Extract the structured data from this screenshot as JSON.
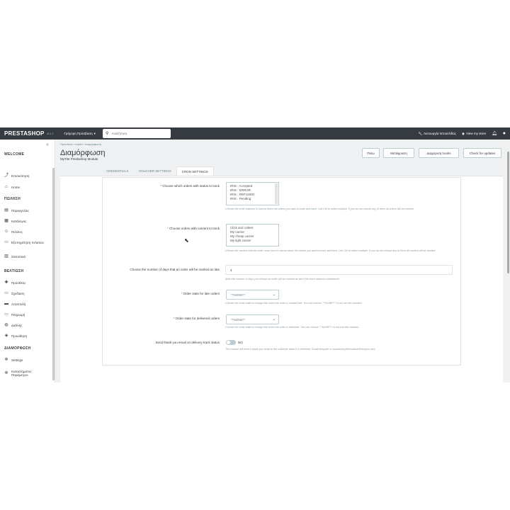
{
  "topbar": {
    "logo": "PRESTASHOP",
    "version": "8.1.7",
    "quick_access": "Γρήγορη Πρόσβαση",
    "search_placeholder": "Αναζήτηση",
    "maintenance": "Λειτουργία Ιστοσελίδας",
    "view_store": "View my store"
  },
  "sidebar": {
    "sections": [
      {
        "title": "WELCOME",
        "items": [
          {
            "label": "Επισκόπηση",
            "icon": "trending-icon"
          },
          {
            "label": "Home",
            "icon": "home-icon"
          }
        ]
      },
      {
        "title": "ΠΩΛΗΣΗ",
        "items": [
          {
            "label": "Παραγγελίες",
            "icon": "orders-icon"
          },
          {
            "label": "Κατάλογος",
            "icon": "catalog-icon"
          },
          {
            "label": "Πελάτες",
            "icon": "customers-icon"
          },
          {
            "label": "Εξυπηρέτηση πελατών",
            "icon": "chat-icon"
          },
          {
            "label": "Στατιστικά",
            "icon": "stats-icon"
          }
        ]
      },
      {
        "title": "ΒΕΛΤΙΩΣΗ",
        "items": [
          {
            "label": "Πρόσθετα",
            "icon": "puzzle-icon"
          },
          {
            "label": "Σχεδίαση",
            "icon": "desktop-icon"
          },
          {
            "label": "Αποστολή",
            "icon": "truck-icon"
          },
          {
            "label": "Πληρωμή",
            "icon": "card-icon"
          },
          {
            "label": "Διεθνής",
            "icon": "globe-icon"
          },
          {
            "label": "Προώθηση",
            "icon": "tag-icon"
          }
        ]
      },
      {
        "title": "ΔΙΑΜΟΡΦΩΣΗ",
        "items": [
          {
            "label": "Settings",
            "icon": "gear-icon"
          },
          {
            "label": "Καταστήματος Παράμετροι",
            "icon": "settings-icon"
          }
        ]
      }
    ]
  },
  "header": {
    "breadcrumb": "Πρόσθετα  /  mytite  /  Διαμόρφωση",
    "title": "Διαμόρφωση",
    "subtitle": "MyTite Prestashop Module",
    "buttons": [
      "Πίσω",
      "Μετάφραση",
      "Διαχείριση hooks",
      "Check for updates"
    ]
  },
  "tabs": [
    "CREDENTIALS",
    "VOUCHER SETTINGS",
    "CRON SETTINGS"
  ],
  "form": {
    "status_label": "Choose which orders with status to track",
    "status_options": [
      "IRIS - Accepted",
      "IRIS - ERROR",
      "IRIS - REFUSED",
      "IRIS - Pending"
    ],
    "status_help": "Choose the order statuses to narrow down the orders you want to track and trace. Use Ctrl to select multiple. If you do not choose any of them all orders will be tracked.",
    "carriers_label": "Choose orders with carriers to track",
    "carrier_options": [
      "Click and collect",
      "My carrier",
      "My cheap carrier",
      "My light carrier"
    ],
    "carriers_help": "Choose the carriers that the order must have to narrow down the orders you want to track and trace. Use Ctrl to select multiple. If you do not choose any of them all carriers will be tracked.",
    "days_label": "Choose the number of days that an order will be marked as late",
    "days_value": "4",
    "days_help": "After this number of days you choose an order will be marked as late if the track status is undelivered.",
    "late_label": "Order state for late orders",
    "late_value": "**NONE**",
    "late_help": "Choose the order state to change into when the order is marked late. You can choose \"**NONE**\" to not use this function.",
    "delivered_label": "Order state for delivered orders",
    "delivered_value": "**NONE**",
    "delivered_help": "Choose the order state to change into when the order is delivered. You can choose \"**NONE**\" to not use this function.",
    "email_label": "Send thank you email on delivery track status",
    "email_toggle": "NO",
    "email_help": "The module will send a thank you email to the customer when it is delivered. Email template in modules/mytite/mails/el/thankyou.html"
  },
  "colors": {
    "topbar": "#363a41",
    "page_bg": "#eff1f2",
    "required": "#c05c67"
  }
}
